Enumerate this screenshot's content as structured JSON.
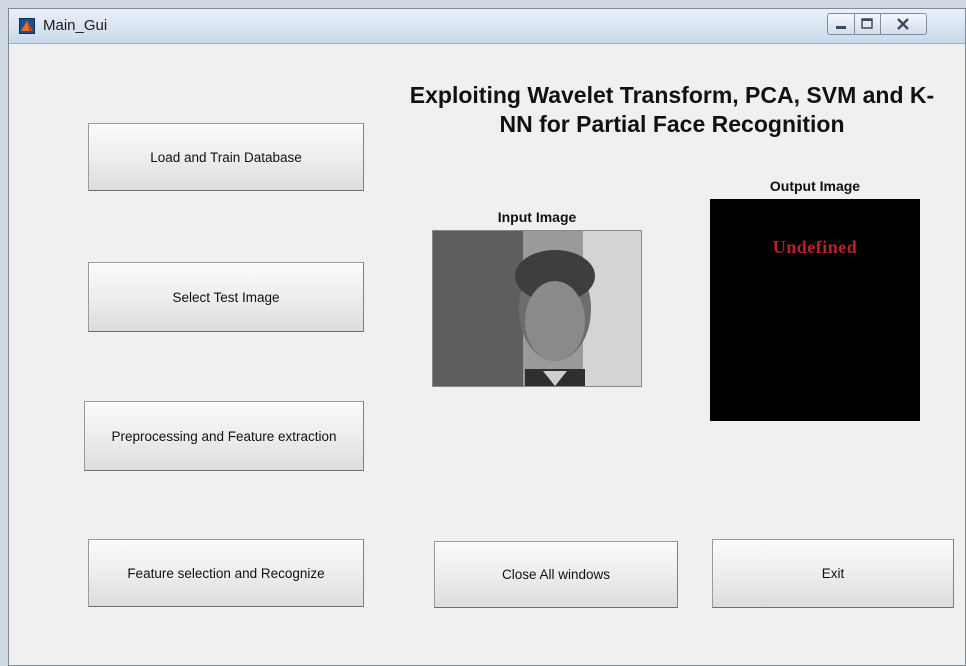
{
  "window": {
    "title": "Main_Gui"
  },
  "heading": "Exploiting Wavelet Transform, PCA, SVM and K-NN for Partial Face Recognition",
  "buttons": {
    "load": "Load  and Train Database",
    "select": "Select Test Image",
    "preprocess": "Preprocessing and Feature extraction",
    "recognize": "Feature selection and Recognize",
    "close_all": "Close All windows",
    "exit": "Exit"
  },
  "panels": {
    "input_label": "Input Image",
    "output_label": "Output Image",
    "output_text": "Undefined"
  },
  "colors": {
    "output_bg": "#000000",
    "output_text": "#b8222a"
  }
}
